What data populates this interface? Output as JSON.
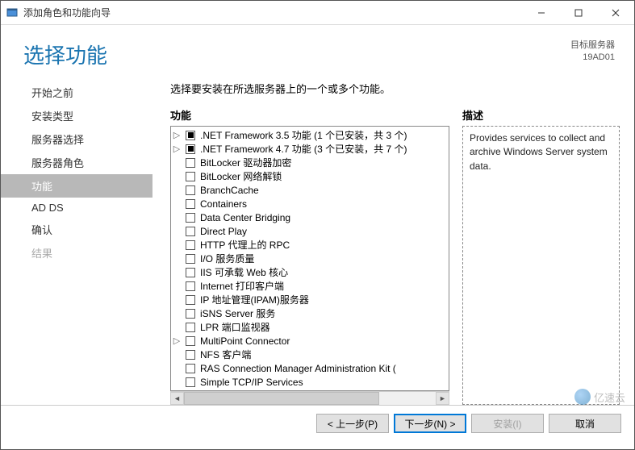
{
  "window": {
    "title": "添加角色和功能向导"
  },
  "header": {
    "page_title": "选择功能",
    "target_label": "目标服务器",
    "target_server": "19AD01"
  },
  "sidebar": {
    "items": [
      {
        "label": "开始之前",
        "selected": false,
        "muted": false
      },
      {
        "label": "安装类型",
        "selected": false,
        "muted": false
      },
      {
        "label": "服务器选择",
        "selected": false,
        "muted": false
      },
      {
        "label": "服务器角色",
        "selected": false,
        "muted": false
      },
      {
        "label": "功能",
        "selected": true,
        "muted": false
      },
      {
        "label": "AD DS",
        "selected": false,
        "muted": false
      },
      {
        "label": "确认",
        "selected": false,
        "muted": false
      },
      {
        "label": "结果",
        "selected": false,
        "muted": true
      }
    ]
  },
  "main": {
    "prompt": "选择要安装在所选服务器上的一个或多个功能。",
    "features_label": "功能",
    "description_label": "描述",
    "description_text": "Provides services to collect and archive Windows Server system data.",
    "tree": [
      {
        "label": ".NET Framework 3.5 功能 (1 个已安装，共 3 个)",
        "state": "partial",
        "expandable": true
      },
      {
        "label": ".NET Framework 4.7 功能 (3 个已安装，共 7 个)",
        "state": "partial",
        "expandable": true
      },
      {
        "label": "BitLocker 驱动器加密",
        "state": "unchecked",
        "expandable": false
      },
      {
        "label": "BitLocker 网络解锁",
        "state": "unchecked",
        "expandable": false
      },
      {
        "label": "BranchCache",
        "state": "unchecked",
        "expandable": false
      },
      {
        "label": "Containers",
        "state": "unchecked",
        "expandable": false
      },
      {
        "label": "Data Center Bridging",
        "state": "unchecked",
        "expandable": false
      },
      {
        "label": "Direct Play",
        "state": "unchecked",
        "expandable": false
      },
      {
        "label": "HTTP 代理上的 RPC",
        "state": "unchecked",
        "expandable": false
      },
      {
        "label": "I/O 服务质量",
        "state": "unchecked",
        "expandable": false
      },
      {
        "label": "IIS 可承载 Web 核心",
        "state": "unchecked",
        "expandable": false
      },
      {
        "label": "Internet 打印客户端",
        "state": "unchecked",
        "expandable": false
      },
      {
        "label": "IP 地址管理(IPAM)服务器",
        "state": "unchecked",
        "expandable": false
      },
      {
        "label": "iSNS Server 服务",
        "state": "unchecked",
        "expandable": false
      },
      {
        "label": "LPR 端口监视器",
        "state": "unchecked",
        "expandable": false
      },
      {
        "label": "MultiPoint Connector",
        "state": "unchecked",
        "expandable": true
      },
      {
        "label": "NFS 客户端",
        "state": "unchecked",
        "expandable": false
      },
      {
        "label": "RAS Connection Manager Administration Kit (",
        "state": "unchecked",
        "expandable": false
      },
      {
        "label": "Simple TCP/IP Services",
        "state": "unchecked",
        "expandable": false
      }
    ]
  },
  "footer": {
    "prev": "< 上一步(P)",
    "next": "下一步(N) >",
    "install": "安装(I)",
    "cancel": "取消"
  },
  "watermark": "亿速云"
}
